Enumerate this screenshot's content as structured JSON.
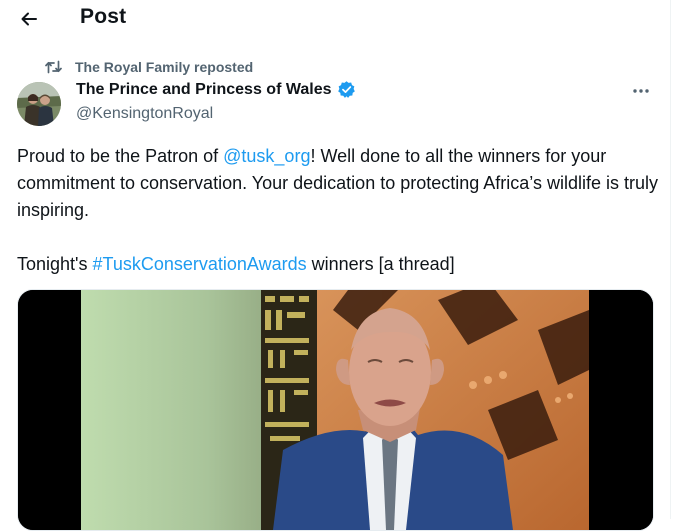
{
  "header": {
    "title": "Post"
  },
  "repost": {
    "label": "The Royal Family reposted"
  },
  "author": {
    "name": "The Prince and Princess of Wales",
    "handle": "@KensingtonRoyal"
  },
  "tweet": {
    "t1": "Proud to be the Patron of ",
    "mention": "@tusk_org",
    "t2": "! Well done to all the winners for your commitment to conservation. Your dedication to protecting Africa’s wildlife is truly inspiring.",
    "t3": "Tonight's ",
    "hashtag": "#TuskConservationAwards",
    "t4": " winners [a thread]"
  },
  "colors": {
    "accent": "#1d9bf0",
    "secondary_text": "#536471",
    "primary_text": "#0f1419",
    "verified": "#1d9bf0"
  },
  "icons": [
    "back-arrow-icon",
    "repost-icon",
    "verified-badge-icon",
    "more-icon"
  ]
}
